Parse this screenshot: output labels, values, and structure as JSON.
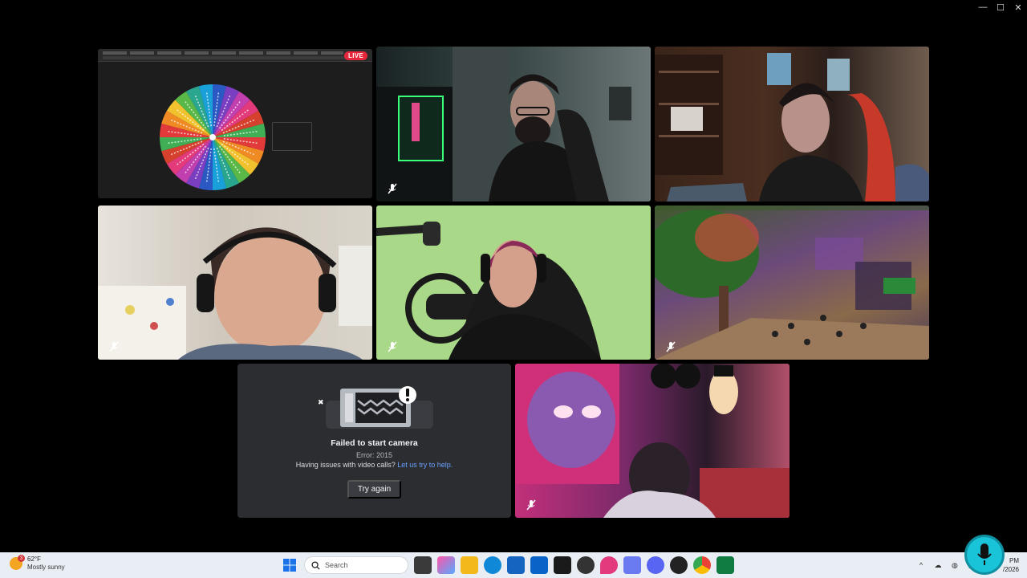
{
  "window": {
    "minimize_label": "—",
    "maximize_label": "☐",
    "close_label": "✕"
  },
  "tiles": {
    "screen_share": {
      "live_label": "LIVE"
    },
    "failed_camera": {
      "title": "Failed to start camera",
      "error": "Error: 2015",
      "help_text": "Having issues with video calls?",
      "help_link": "Let us try to help.",
      "retry_label": "Try again"
    }
  },
  "wheel": {
    "colors": [
      "#e23a3a",
      "#f08a24",
      "#f2c12e",
      "#59b847",
      "#2aa68f",
      "#1aa0d8",
      "#2b59c3",
      "#7a3fc0",
      "#c23fb0",
      "#e23a7a",
      "#d6412d",
      "#3fae55"
    ]
  },
  "taskbar": {
    "weather_temp": "62°F",
    "weather_condition": "Mostly sunny",
    "weather_badge": "3",
    "search_placeholder": "Search",
    "clock_time": "PM",
    "clock_date": "/2026"
  },
  "colors": {
    "accent_link": "#6aa2ff",
    "live": "#e5263b",
    "mic_overlay": "#19c3d8"
  }
}
